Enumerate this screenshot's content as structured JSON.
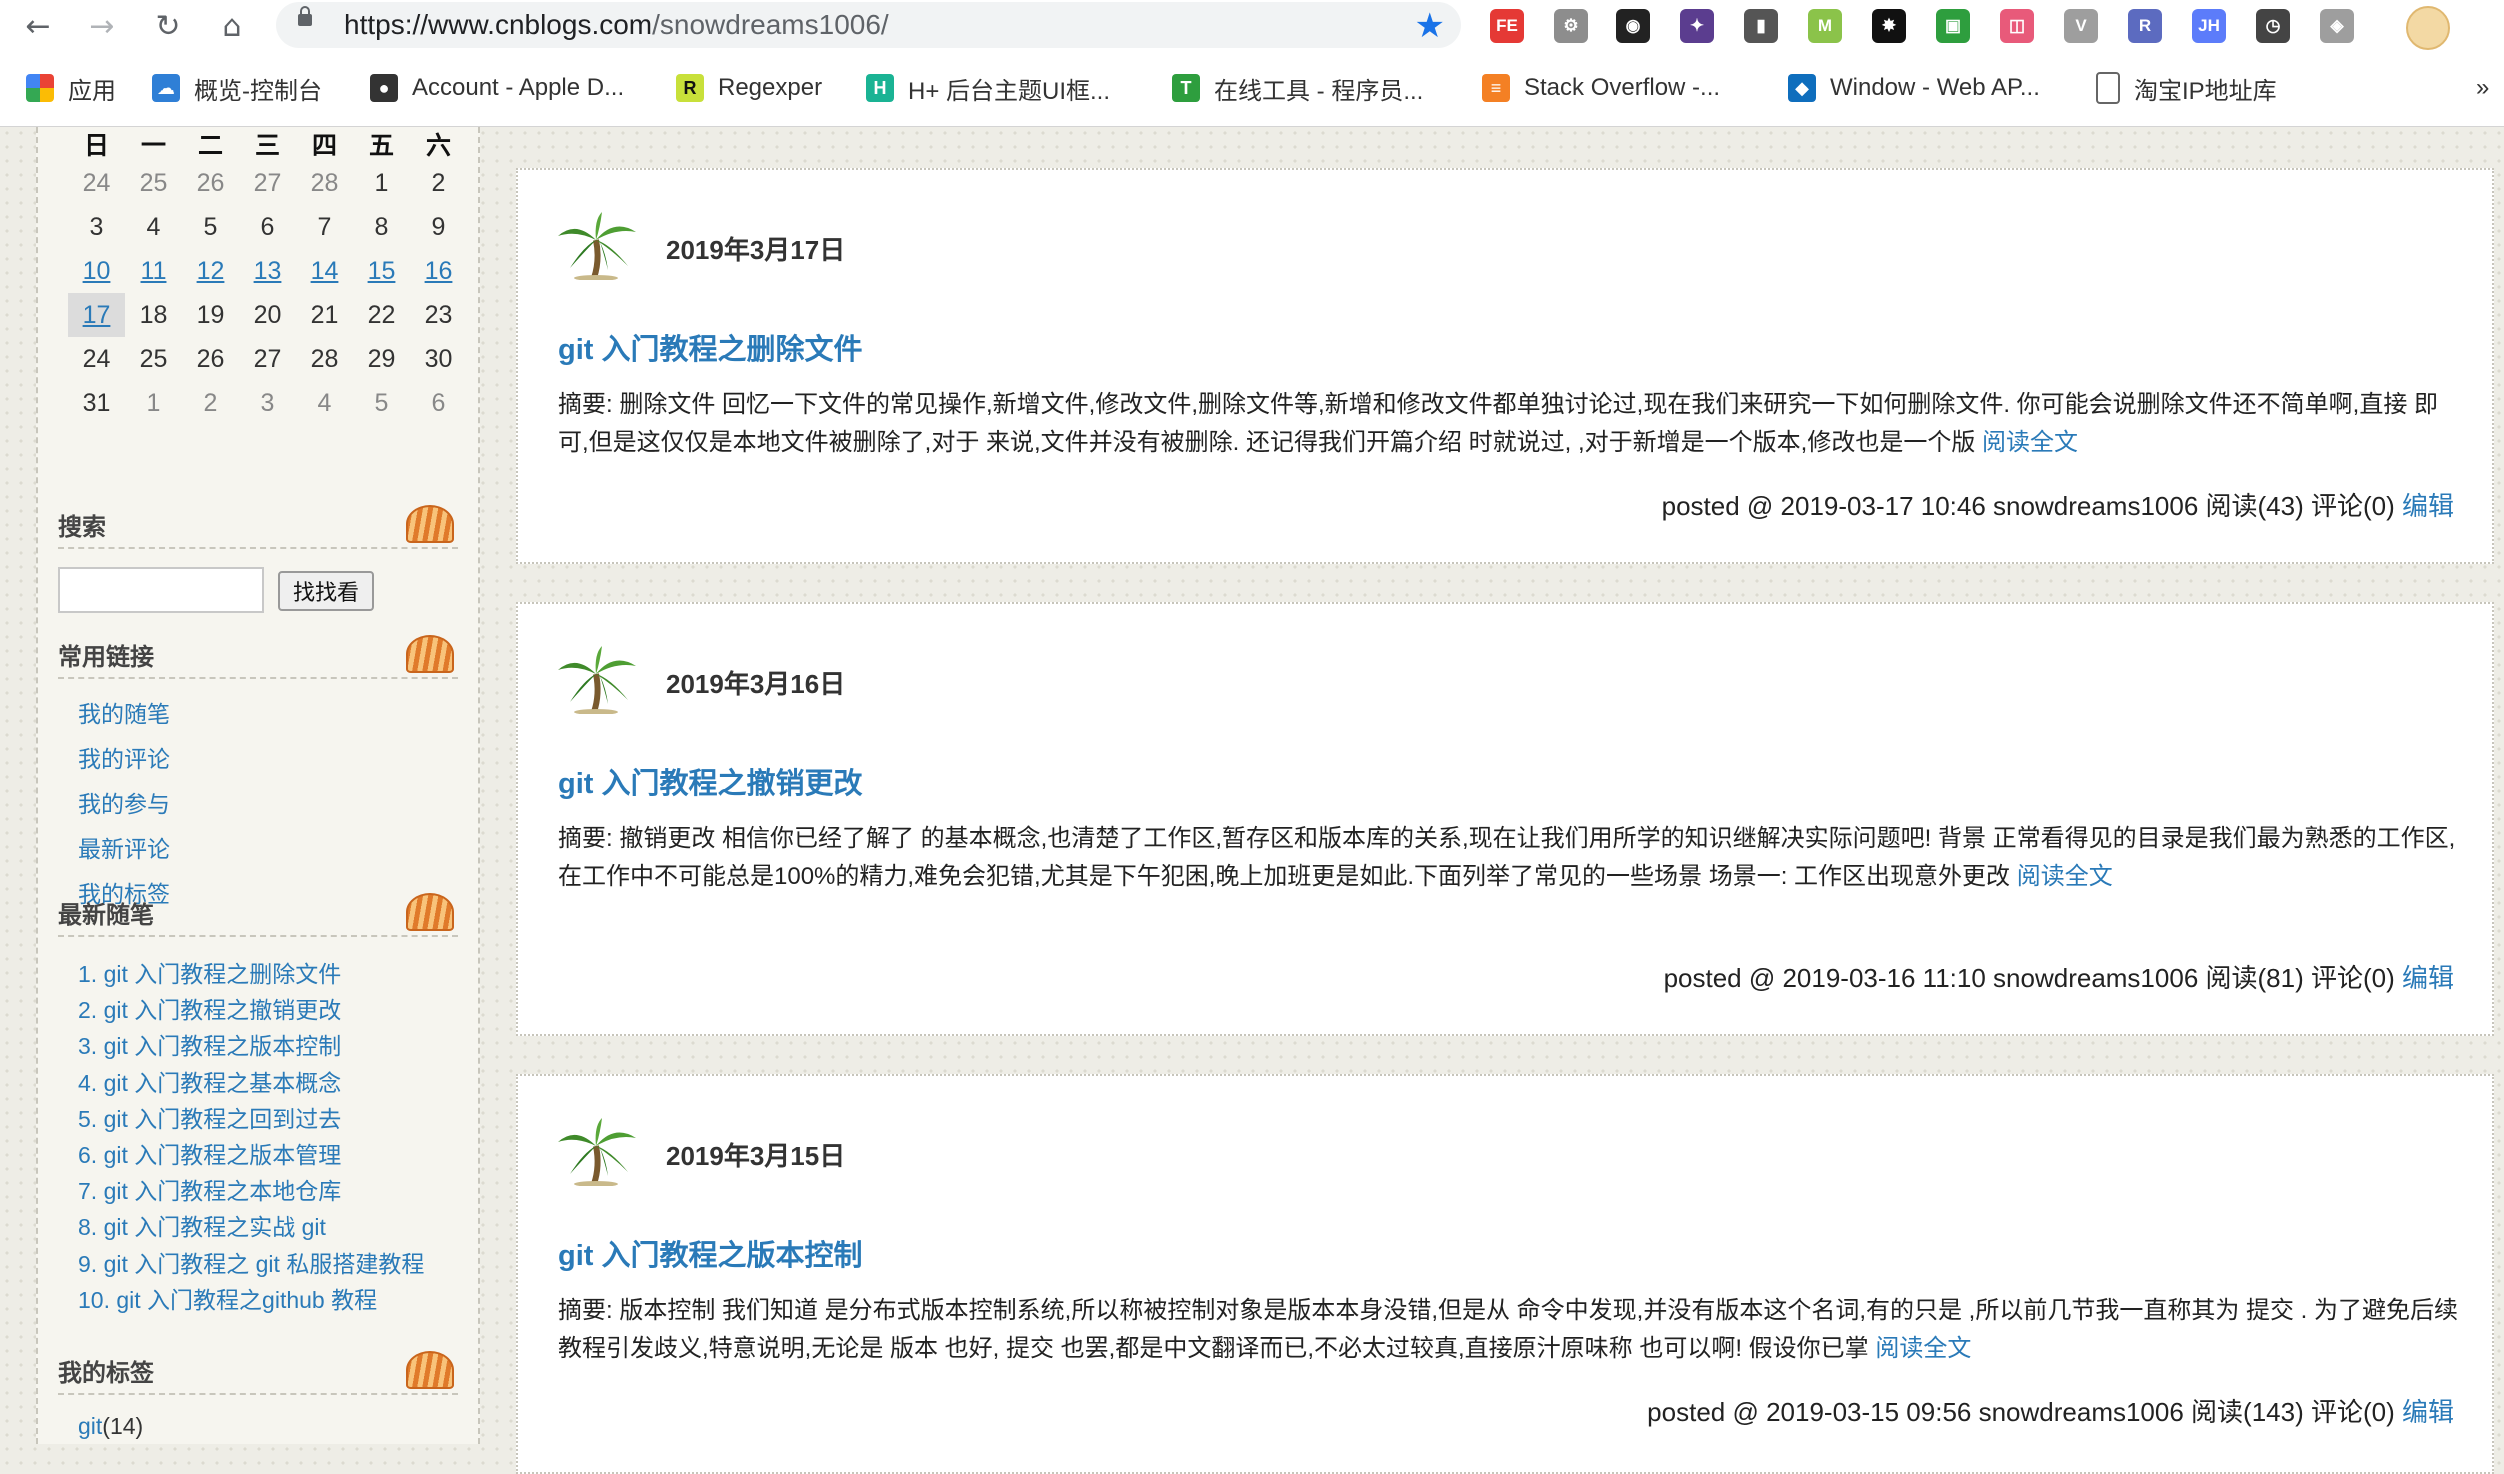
{
  "browser": {
    "url_scheme_host": "https://www.cnblogs.com",
    "url_path": "/snowdreams1006/",
    "bookmarks": [
      {
        "label": "应用"
      },
      {
        "label": "概览-控制台"
      },
      {
        "label": "Account - Apple D..."
      },
      {
        "label": "Regexper"
      },
      {
        "label": "H+ 后台主题UI框..."
      },
      {
        "label": "在线工具 - 程序员..."
      },
      {
        "label": "Stack Overflow -..."
      },
      {
        "label": "Window - Web AP..."
      },
      {
        "label": "淘宝IP地址库"
      }
    ],
    "bookmarks_more": "»",
    "extensions": [
      {
        "label": "FE",
        "color": "#e53935"
      },
      {
        "label": "⚙",
        "color": "#8d8d8d"
      },
      {
        "label": "◉",
        "color": "#222222"
      },
      {
        "label": "✦",
        "color": "#5b3d8f"
      },
      {
        "label": "▮",
        "color": "#555555"
      },
      {
        "label": "M",
        "color": "#8bc34a"
      },
      {
        "label": "✸",
        "color": "#111111"
      },
      {
        "label": "▣",
        "color": "#2e9e3e"
      },
      {
        "label": "◫",
        "color": "#e85a7a"
      },
      {
        "label": "V",
        "color": "#9e9e9e"
      },
      {
        "label": "R",
        "color": "#5c6bc0"
      },
      {
        "label": "JH",
        "color": "#5c7cfa"
      },
      {
        "label": "◷",
        "color": "#444444"
      },
      {
        "label": "◈",
        "color": "#9e9e9e"
      }
    ]
  },
  "calendar": {
    "weekdays": [
      "日",
      "一",
      "二",
      "三",
      "四",
      "五",
      "六"
    ],
    "weeks": [
      [
        {
          "d": "24",
          "t": "other"
        },
        {
          "d": "25",
          "t": "other"
        },
        {
          "d": "26",
          "t": "other"
        },
        {
          "d": "27",
          "t": "other"
        },
        {
          "d": "28",
          "t": "other"
        },
        {
          "d": "1",
          "t": ""
        },
        {
          "d": "2",
          "t": ""
        }
      ],
      [
        {
          "d": "3",
          "t": ""
        },
        {
          "d": "4",
          "t": ""
        },
        {
          "d": "5",
          "t": ""
        },
        {
          "d": "6",
          "t": ""
        },
        {
          "d": "7",
          "t": ""
        },
        {
          "d": "8",
          "t": ""
        },
        {
          "d": "9",
          "t": ""
        }
      ],
      [
        {
          "d": "10",
          "t": "link"
        },
        {
          "d": "11",
          "t": "link"
        },
        {
          "d": "12",
          "t": "link"
        },
        {
          "d": "13",
          "t": "link"
        },
        {
          "d": "14",
          "t": "link"
        },
        {
          "d": "15",
          "t": "link"
        },
        {
          "d": "16",
          "t": "link"
        }
      ],
      [
        {
          "d": "17",
          "t": "link today"
        },
        {
          "d": "18",
          "t": ""
        },
        {
          "d": "19",
          "t": ""
        },
        {
          "d": "20",
          "t": ""
        },
        {
          "d": "21",
          "t": ""
        },
        {
          "d": "22",
          "t": ""
        },
        {
          "d": "23",
          "t": ""
        }
      ],
      [
        {
          "d": "24",
          "t": ""
        },
        {
          "d": "25",
          "t": ""
        },
        {
          "d": "26",
          "t": ""
        },
        {
          "d": "27",
          "t": ""
        },
        {
          "d": "28",
          "t": ""
        },
        {
          "d": "29",
          "t": ""
        },
        {
          "d": "30",
          "t": ""
        }
      ],
      [
        {
          "d": "31",
          "t": ""
        },
        {
          "d": "1",
          "t": "other"
        },
        {
          "d": "2",
          "t": "other"
        },
        {
          "d": "3",
          "t": "other"
        },
        {
          "d": "4",
          "t": "other"
        },
        {
          "d": "5",
          "t": "other"
        },
        {
          "d": "6",
          "t": "other"
        }
      ]
    ]
  },
  "sidebar": {
    "search_title": "搜索",
    "search_button": "找找看",
    "links_title": "常用链接",
    "links": [
      "我的随笔",
      "我的评论",
      "我的参与",
      "最新评论",
      "我的标签"
    ],
    "recent_title": "最新随笔",
    "recent_posts": [
      "1. git 入门教程之删除文件",
      "2. git 入门教程之撤销更改",
      "3. git 入门教程之版本控制",
      "4. git 入门教程之基本概念",
      "5. git 入门教程之回到过去",
      "6. git 入门教程之版本管理",
      "7. git 入门教程之本地仓库",
      "8. git 入门教程之实战 git",
      "9. git 入门教程之 git 私服搭建教程",
      "10. git 入门教程之github 教程"
    ],
    "tags_title": "我的标签",
    "tags": [
      {
        "name": "git",
        "count": "(14)"
      }
    ]
  },
  "posts": [
    {
      "date": "2019年3月17日",
      "title": "git 入门教程之删除文件",
      "summary": "摘要: 删除文件 回忆一下文件的常见操作,新增文件,修改文件,删除文件等,新增和修改文件都单独讨论过,现在我们来研究一下如何删除文件. 你可能会说删除文件还不简单啊,直接 即可,但是这仅仅是本地文件被删除了,对于 来说,文件并没有被删除. 还记得我们开篇介绍 时就说过, ,对于新增是一个版本,修改也是一个版",
      "read_more": "阅读全文",
      "footer": "posted @ 2019-03-17 10:46 snowdreams1006 阅读(43) 评论(0)",
      "edit": "编辑"
    },
    {
      "date": "2019年3月16日",
      "title": "git 入门教程之撤销更改",
      "summary": "摘要: 撤销更改 相信你已经了解了 的基本概念,也清楚了工作区,暂存区和版本库的关系,现在让我们用所学的知识继解决实际问题吧! 背景 正常看得见的目录是我们最为熟悉的工作区,在工作中不可能总是100%的精力,难免会犯错,尤其是下午犯困,晚上加班更是如此.下面列举了常见的一些场景 场景一: 工作区出现意外更改",
      "read_more": "阅读全文",
      "footer": "posted @ 2019-03-16 11:10 snowdreams1006 阅读(81) 评论(0)",
      "edit": "编辑"
    },
    {
      "date": "2019年3月15日",
      "title": "git 入门教程之版本控制",
      "summary": "摘要: 版本控制 我们知道 是分布式版本控制系统,所以称被控制对象是版本本身没错,但是从 命令中发现,并没有版本这个名词,有的只是 ,所以前几节我一直称其为 提交 . 为了避免后续教程引发歧义,特意说明,无论是 版本 也好, 提交 也罢,都是中文翻译而已,不必太过较真,直接原汁原味称 也可以啊! 假设你已掌",
      "read_more": "阅读全文",
      "footer": "posted @ 2019-03-15 09:56 snowdreams1006 阅读(143) 评论(0)",
      "edit": "编辑"
    }
  ]
}
